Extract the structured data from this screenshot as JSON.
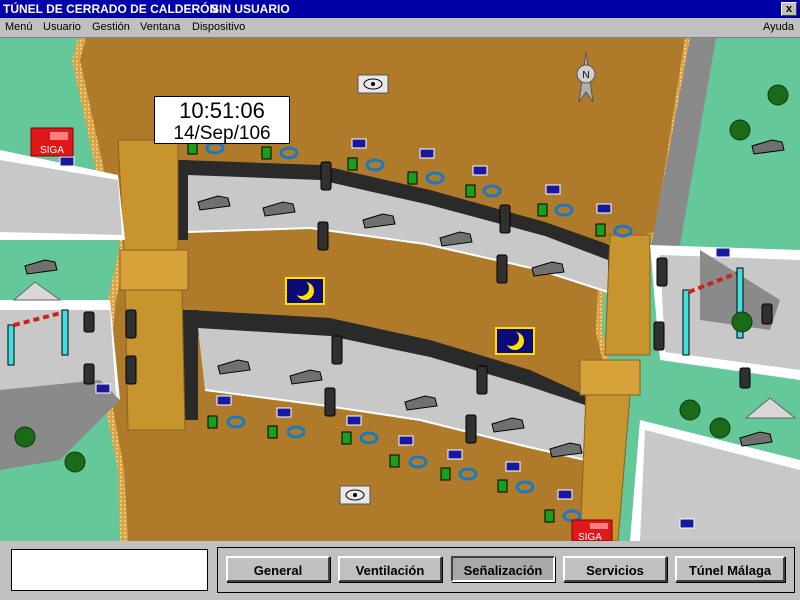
{
  "window": {
    "title": "TÚNEL DE CERRADO DE CALDERÓN",
    "user_status": "SIN USUARIO",
    "close_glyph": "x"
  },
  "menu": {
    "items": [
      "Menú",
      "Usuario",
      "Gestión",
      "Ventana",
      "Dispositivo"
    ],
    "help": "Ayuda"
  },
  "clock": {
    "time": "10:51:06",
    "date": "14/Sep/106"
  },
  "map": {
    "compass_label": "N",
    "siga_label": "SIGA",
    "colors": {
      "ground": "#b07c2c",
      "grass": "#64c89a",
      "road": "#c8c8c8",
      "tunnel_wall": "#2a2a2a",
      "dotted_edge": "#e8b860"
    }
  },
  "buttons": [
    "General",
    "Ventilación",
    "Señalización",
    "Servicios",
    "Túnel Málaga"
  ],
  "active_button": "Señalización",
  "message_box": ""
}
